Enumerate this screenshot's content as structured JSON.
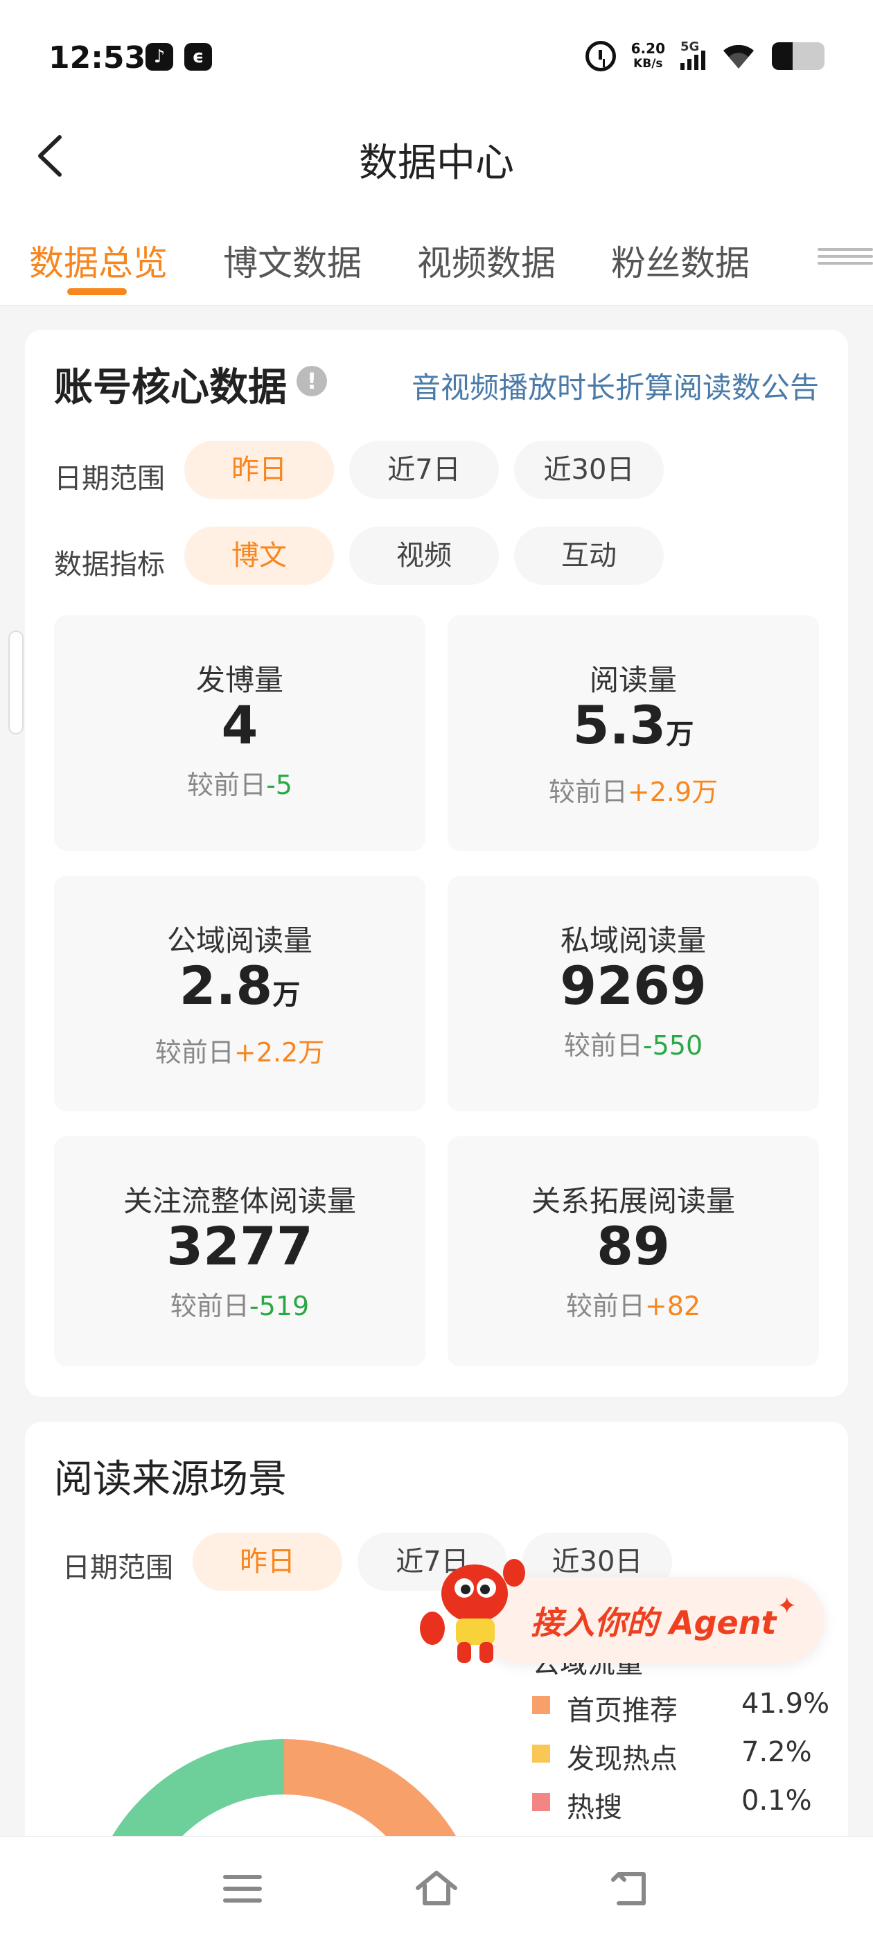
{
  "status_bar": {
    "time": "12:53",
    "net_speed_value": "6.20",
    "net_speed_unit": "KB/s",
    "network_label": "5G",
    "battery_level": 0.4,
    "icons": [
      "tiktok-icon",
      "chat-icon",
      "alarm-icon",
      "signal-icon",
      "wifi-icon",
      "battery-icon"
    ]
  },
  "header": {
    "title": "数据中心"
  },
  "tabs": [
    {
      "label": "数据总览",
      "active": true
    },
    {
      "label": "博文数据",
      "active": false
    },
    {
      "label": "视频数据",
      "active": false
    },
    {
      "label": "粉丝数据",
      "active": false
    }
  ],
  "core": {
    "title": "账号核心数据",
    "notice_link": "音视频播放时长折算阅读数公告",
    "date_range_label": "日期范围",
    "date_options": [
      "昨日",
      "近7日",
      "近30日"
    ],
    "metric_label": "数据指标",
    "metric_options": [
      "博文",
      "视频",
      "互动"
    ],
    "compare_prefix": "较前日",
    "metrics": [
      {
        "label": "发博量",
        "value": "4",
        "unit": "",
        "change": "-5",
        "trend": "down"
      },
      {
        "label": "阅读量",
        "value": "5.3",
        "unit": "万",
        "change": "+2.9万",
        "trend": "up"
      },
      {
        "label": "公域阅读量",
        "value": "2.8",
        "unit": "万",
        "change": "+2.2万",
        "trend": "up"
      },
      {
        "label": "私域阅读量",
        "value": "9269",
        "unit": "",
        "change": "-550",
        "trend": "down"
      },
      {
        "label": "关注流整体阅读量",
        "value": "3277",
        "unit": "",
        "change": "-519",
        "trend": "down"
      },
      {
        "label": "关系拓展阅读量",
        "value": "89",
        "unit": "",
        "change": "+82",
        "trend": "up"
      }
    ]
  },
  "source": {
    "title": "阅读来源场景",
    "date_range_label": "日期范围",
    "date_options": [
      "昨日",
      "近7日",
      "近30日"
    ],
    "legend_header": "公域流量",
    "legend": [
      {
        "name": "首页推荐",
        "pct": "41.9%",
        "color": "#f7a06a"
      },
      {
        "name": "发现热点",
        "pct": "7.2%",
        "color": "#f8c755"
      },
      {
        "name": "热搜",
        "pct": "0.1%",
        "color": "#f48585"
      }
    ],
    "donut_colors": [
      "#6dd09a",
      "#f7a06a"
    ]
  },
  "agent_banner": {
    "text": "接入你的 Agent"
  }
}
